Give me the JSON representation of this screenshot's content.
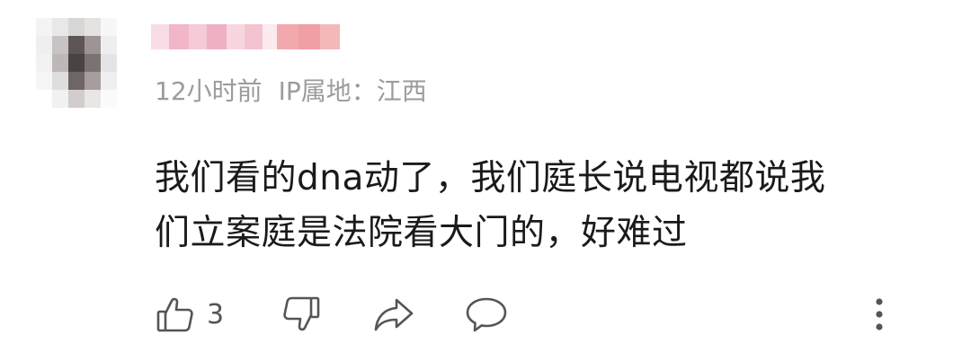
{
  "comment": {
    "meta": {
      "time": "12小时前",
      "ip_location": "IP属地：江西"
    },
    "content_line1": "我们看的dna动了，我们庭长说电视都说我",
    "content_line2": "们立案庭是法院看大门的，好难过",
    "actions": {
      "like_count": "3"
    },
    "icons": {
      "like": "thumbs-up-icon",
      "dislike": "thumbs-down-icon",
      "share": "share-arrow-icon",
      "reply": "comment-bubble-icon",
      "more": "more-vertical-icon"
    },
    "colors": {
      "text": "#1a1a1a",
      "meta": "#9b9b9b",
      "icon": "#555555"
    }
  }
}
